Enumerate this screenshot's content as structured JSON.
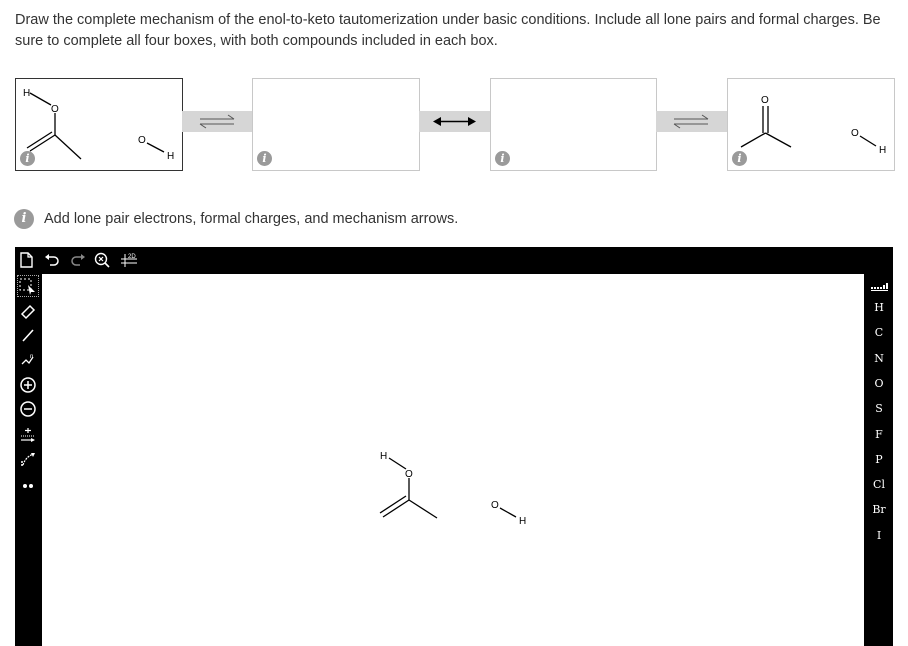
{
  "question": {
    "text": "Draw the complete mechanism of the enol-to-keto tautomerization under basic conditions. Include all lone pairs and formal charges. Be sure to complete all four boxes, with both compounds included in each box."
  },
  "mechanism_boxes": [
    {
      "label": "box-1",
      "atoms": {
        "h_enol": "H",
        "o_enol": "O",
        "o_hydroxide": "O",
        "h_hydroxide": "H"
      }
    },
    {
      "label": "box-2",
      "atoms": {}
    },
    {
      "label": "box-3",
      "atoms": {}
    },
    {
      "label": "box-4",
      "atoms": {
        "o_carbonyl": "O",
        "o_water": "O",
        "h_water": "H"
      }
    }
  ],
  "info_glyph": "i",
  "hint": {
    "text": "Add lone pair electrons, formal charges, and mechanism arrows."
  },
  "editor": {
    "top_toolbar": {
      "new_icon": "document-icon",
      "undo_icon": "undo-icon",
      "redo_icon": "redo-icon",
      "zoom_icon": "zoom-icon",
      "view_2d_label": "2D"
    },
    "left_tools": [
      {
        "name": "select-tool",
        "glyph": "⬚"
      },
      {
        "name": "eraser-tool",
        "glyph": "⌫"
      },
      {
        "name": "bond-tool",
        "glyph": "╱"
      },
      {
        "name": "chain-tool",
        "glyph": "〰"
      },
      {
        "name": "positive-charge-tool",
        "glyph": "+"
      },
      {
        "name": "negative-charge-tool",
        "glyph": "−"
      },
      {
        "name": "arrow-tool",
        "glyph": "⇢"
      },
      {
        "name": "curved-arrow-tool",
        "glyph": "↷"
      },
      {
        "name": "lone-pair-tool",
        "glyph": "••"
      }
    ],
    "elements": [
      "H",
      "C",
      "N",
      "O",
      "S",
      "F",
      "P",
      "Cl",
      "Br",
      "I"
    ],
    "canvas_molecule": {
      "h_enol": "H",
      "o_enol": "O",
      "o_hydroxide": "O",
      "h_hydroxide": "H"
    }
  }
}
